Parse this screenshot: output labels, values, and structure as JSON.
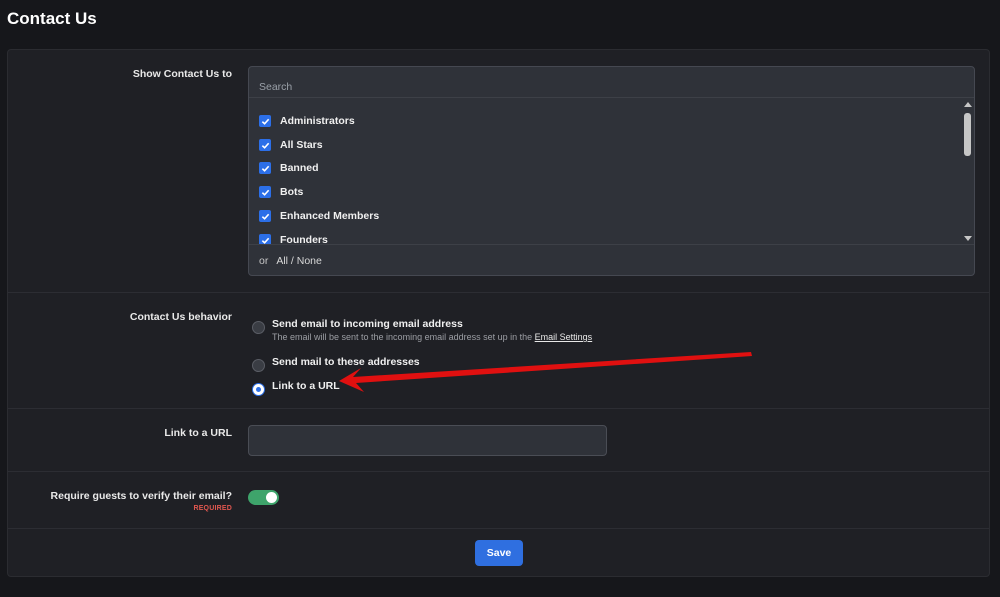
{
  "page": {
    "title": "Contact Us"
  },
  "show_contact": {
    "label": "Show Contact Us to",
    "search_placeholder": "Search",
    "items": [
      {
        "label": "Administrators",
        "checked": true
      },
      {
        "label": "All Stars",
        "checked": true
      },
      {
        "label": "Banned",
        "checked": true
      },
      {
        "label": "Bots",
        "checked": true
      },
      {
        "label": "Enhanced Members",
        "checked": true
      },
      {
        "label": "Founders",
        "checked": true
      }
    ],
    "or_text": "or",
    "all_none": "All / None"
  },
  "behavior": {
    "label": "Contact Us behavior",
    "options": [
      {
        "label": "Send email to incoming email address",
        "desc": "The email will be sent to the incoming email address set up in the",
        "desc_link": "Email Settings",
        "checked": false
      },
      {
        "label": "Send mail to these addresses",
        "checked": false
      },
      {
        "label": "Link to a URL",
        "checked": true
      }
    ]
  },
  "link_url": {
    "label": "Link to a URL",
    "value": ""
  },
  "verify_email": {
    "label": "Require guests to verify their email?",
    "required": "REQUIRED",
    "enabled": true
  },
  "save_label": "Save",
  "colors": {
    "accent": "#2f6fe0",
    "toggle_on": "#3ea46b",
    "arrow": "#e01010",
    "required": "#e0574f"
  }
}
